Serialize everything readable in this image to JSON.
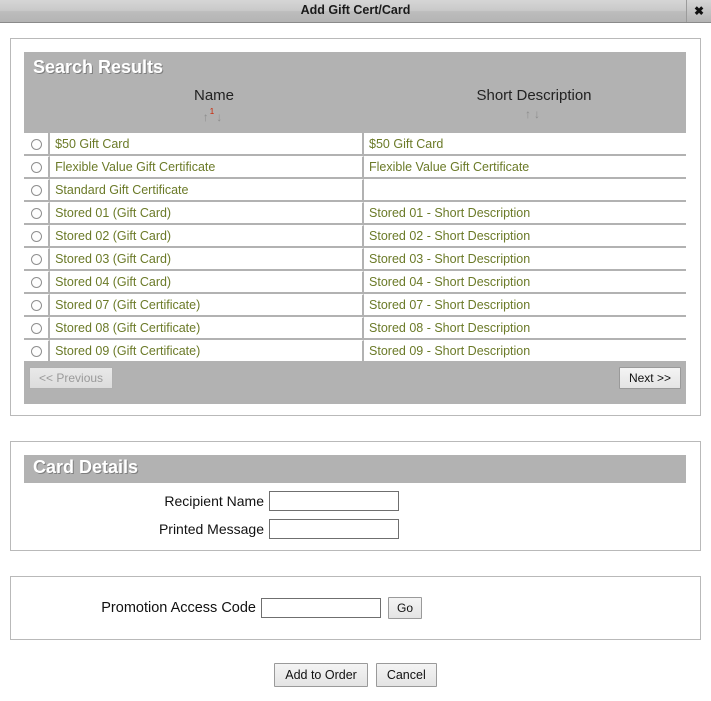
{
  "window": {
    "title": "Add Gift Cert/Card",
    "close_label": "✖"
  },
  "search_results": {
    "heading": "Search Results",
    "columns": [
      {
        "label": "Name",
        "sort_up": "↑",
        "sort_down": "↓",
        "sort_rank": "1"
      },
      {
        "label": "Short Description",
        "sort_up": "↑",
        "sort_down": "↓",
        "sort_rank": ""
      }
    ],
    "rows": [
      {
        "name": "$50 Gift Card",
        "description": "$50 Gift Card"
      },
      {
        "name": "Flexible Value Gift Certificate",
        "description": "Flexible Value Gift Certificate"
      },
      {
        "name": "Standard Gift Certificate",
        "description": ""
      },
      {
        "name": "Stored 01 (Gift Card)",
        "description": "Stored 01 - Short Description"
      },
      {
        "name": "Stored 02 (Gift Card)",
        "description": "Stored 02 - Short Description"
      },
      {
        "name": "Stored 03 (Gift Card)",
        "description": "Stored 03 - Short Description"
      },
      {
        "name": "Stored 04 (Gift Card)",
        "description": "Stored 04 - Short Description"
      },
      {
        "name": "Stored 07 (Gift Certificate)",
        "description": "Stored 07 - Short Description"
      },
      {
        "name": "Stored 08 (Gift Certificate)",
        "description": "Stored 08 - Short Description"
      },
      {
        "name": "Stored 09 (Gift Certificate)",
        "description": "Stored 09 - Short Description"
      }
    ],
    "pager": {
      "previous_label": "<< Previous",
      "next_label": "Next >>"
    }
  },
  "card_details": {
    "heading": "Card Details",
    "recipient_name": {
      "label": "Recipient Name",
      "value": "",
      "placeholder": ""
    },
    "printed_message": {
      "label": "Printed Message",
      "value": "",
      "placeholder": ""
    }
  },
  "promotion": {
    "label": "Promotion Access Code",
    "value": "",
    "placeholder": "",
    "go_label": "Go"
  },
  "footer": {
    "add_to_order_label": "Add to Order",
    "cancel_label": "Cancel"
  },
  "colors": {
    "link": "#6b7a28",
    "section_bar": "#b2b2b2",
    "titlebar": "#c4c4c4",
    "sort_rank": "#cc2200"
  }
}
